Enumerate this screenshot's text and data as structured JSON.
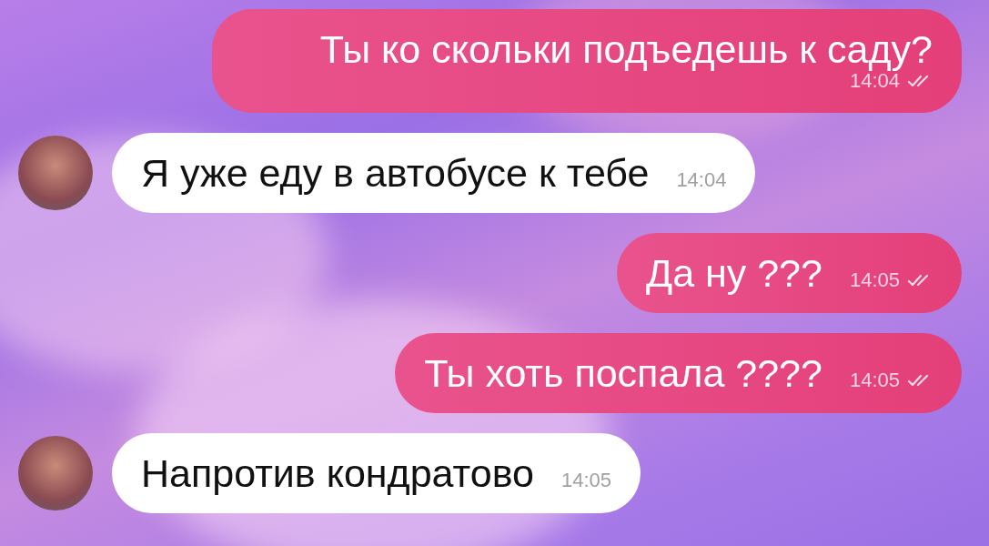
{
  "messages": [
    {
      "kind": "outgoing",
      "text": "Ты ко скольки подъедешь к саду?",
      "time": "14:04",
      "read": true,
      "avatar": false
    },
    {
      "kind": "incoming",
      "text": "Я уже еду в автобусе к тебе",
      "time": "14:04",
      "read": false,
      "avatar": true
    },
    {
      "kind": "outgoing",
      "text": "Да ну ???",
      "time": "14:05",
      "read": true,
      "avatar": false
    },
    {
      "kind": "outgoing",
      "text": "Ты хоть поспала ????",
      "time": "14:05",
      "read": true,
      "avatar": false
    },
    {
      "kind": "incoming",
      "text": "Напротив кондратово",
      "time": "14:05",
      "read": false,
      "avatar": true
    }
  ]
}
